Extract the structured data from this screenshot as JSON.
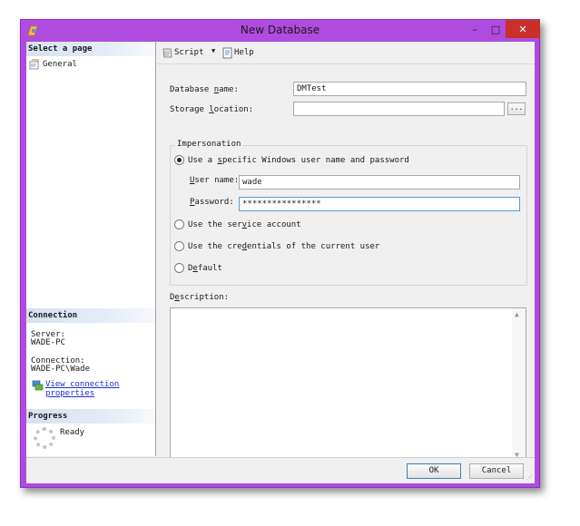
{
  "window": {
    "title": "New Database",
    "min_label": "–",
    "max_label": "□",
    "close_label": "✕"
  },
  "left_panel": {
    "select_page_heading": "Select a page",
    "pages": [
      {
        "label": "General"
      }
    ],
    "connection_heading": "Connection",
    "server_label": "Server:",
    "server_value": "WADE-PC",
    "connection_label": "Connection:",
    "connection_value": "WADE-PC\\Wade",
    "view_link_line1": "View connection",
    "view_link_line2": "properties",
    "progress_heading": "Progress",
    "progress_status": "Ready"
  },
  "toolbar": {
    "script_label": "Script",
    "dropdown_arrow": "▼",
    "help_label": "Help"
  },
  "form": {
    "db_name_pre": "Database ",
    "db_name_u": "n",
    "db_name_post": "ame:",
    "db_name_value": "DMTest",
    "storage_pre": "Storage ",
    "storage_u": "l",
    "storage_post": "ocation:",
    "storage_value": "",
    "browse_label": "...",
    "impersonation_heading": "Impersonation",
    "radio_specific_pre": "Use a ",
    "radio_specific_u": "s",
    "radio_specific_post": "pecific Windows user name and password",
    "user_label_u": "U",
    "user_label_post": "ser name:",
    "user_value": "wade",
    "pw_label_u": "P",
    "pw_label_post": "assword:",
    "pw_value": "****************",
    "radio_service_pre": "Use the ser",
    "radio_service_u": "v",
    "radio_service_post": "ice account",
    "radio_cred_pre": "Use the cre",
    "radio_cred_u": "d",
    "radio_cred_post": "entials of the current user",
    "radio_default_pre": "D",
    "radio_default_u": "e",
    "radio_default_post": "fault",
    "selected_option": "specific",
    "description_pre": "D",
    "description_u": "e",
    "description_post": "scription:",
    "description_value": ""
  },
  "buttons": {
    "ok_label": "OK",
    "cancel_label": "Cancel"
  },
  "colors": {
    "title_bar": "#b04be0",
    "close_button": "#c9302c",
    "link": "#1a2fd0",
    "section_header": "#d7e1ef"
  }
}
